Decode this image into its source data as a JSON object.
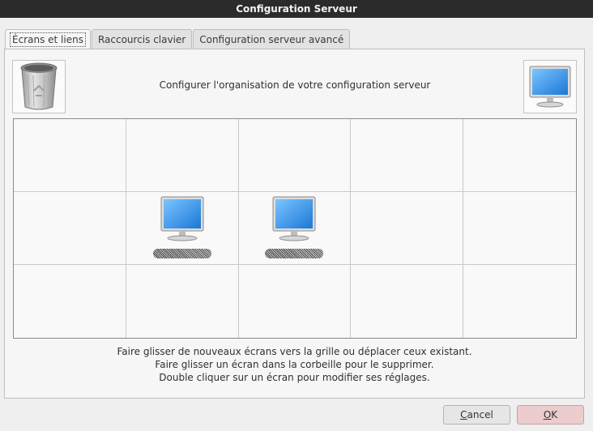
{
  "window": {
    "title": "Configuration Serveur"
  },
  "tabs": [
    {
      "label": "Écrans et liens",
      "active": true
    },
    {
      "label": "Raccourcis clavier",
      "active": false
    },
    {
      "label": "Configuration serveur avancé",
      "active": false
    }
  ],
  "screens_tab": {
    "header": "Configurer l'organisation de votre configuration serveur",
    "trash_icon": "trash-can-icon",
    "new_screen_icon": "monitor-icon",
    "grid": {
      "columns": 5,
      "rows": 3
    },
    "screens": [
      {
        "row": 1,
        "col": 1,
        "icon": "monitor-icon"
      },
      {
        "row": 1,
        "col": 2,
        "icon": "monitor-icon"
      }
    ],
    "help_lines": [
      "Faire glisser de nouveaux écrans vers la grille ou déplacer ceux existant.",
      "Faire glisser un écran dans la corbeille pour le supprimer.",
      "Double cliquer sur un écran pour modifier ses réglages."
    ]
  },
  "buttons": {
    "cancel": "Cancel",
    "ok": "OK"
  },
  "colors": {
    "titlebar": "#2b2b2b",
    "ok_button": "#eccccc",
    "monitor_screen": "#2a8fe0"
  }
}
